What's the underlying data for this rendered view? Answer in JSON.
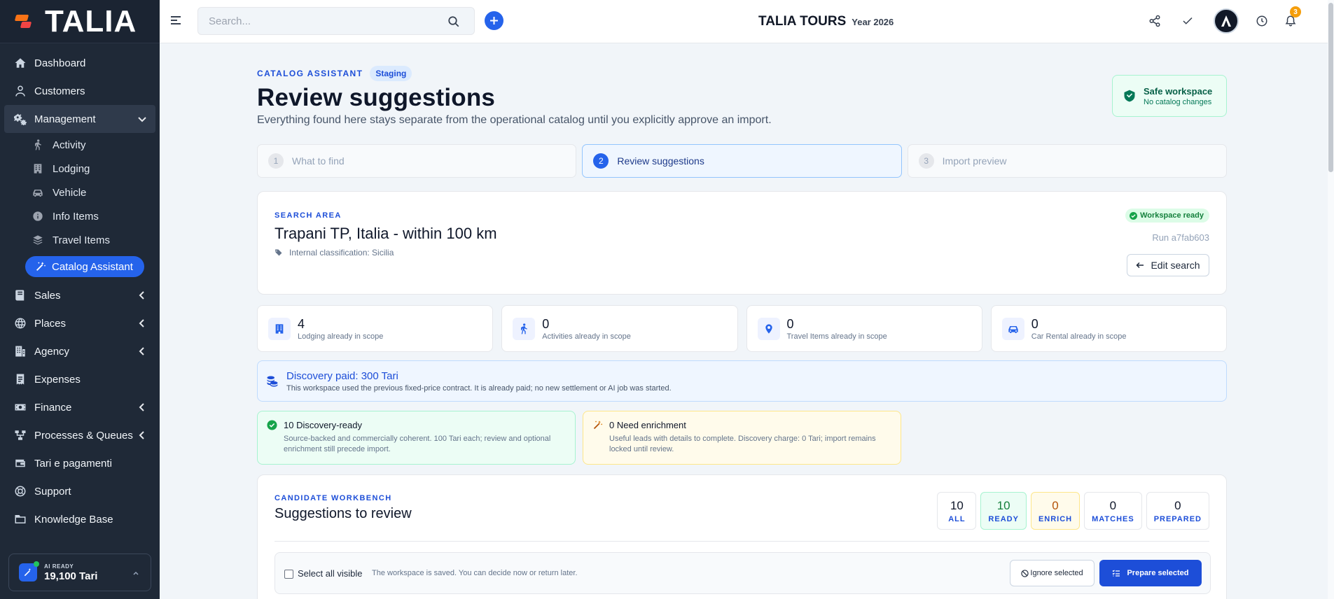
{
  "brand": {
    "name": "TALIA"
  },
  "header": {
    "search_placeholder": "Search...",
    "title": "TALIA TOURS",
    "year": "Year 2026",
    "notification_count": "3"
  },
  "sidebar": {
    "items": [
      {
        "label": "Dashboard",
        "icon": "home-icon"
      },
      {
        "label": "Customers",
        "icon": "user-icon"
      },
      {
        "label": "Management",
        "icon": "gears-icon",
        "expanded": true
      },
      {
        "label": "Sales",
        "icon": "book-icon"
      },
      {
        "label": "Places",
        "icon": "globe-icon"
      },
      {
        "label": "Agency",
        "icon": "building-icon"
      },
      {
        "label": "Expenses",
        "icon": "receipt-icon"
      },
      {
        "label": "Finance",
        "icon": "banknote-icon"
      },
      {
        "label": "Processes & Queues",
        "icon": "sitemap-icon"
      },
      {
        "label": "Tari e pagamenti",
        "icon": "wallet-icon"
      },
      {
        "label": "Support",
        "icon": "lifebuoy-icon"
      },
      {
        "label": "Knowledge Base",
        "icon": "folder-icon"
      }
    ],
    "sub_items": [
      {
        "label": "Activity",
        "icon": "hiking-icon"
      },
      {
        "label": "Lodging",
        "icon": "hotel-icon"
      },
      {
        "label": "Vehicle",
        "icon": "car-icon"
      },
      {
        "label": "Info Items",
        "icon": "info-icon"
      },
      {
        "label": "Travel Items",
        "icon": "layers-icon"
      }
    ],
    "active_item": "Catalog Assistant",
    "ai_card": {
      "label": "AI READY",
      "value": "19,100 Tari"
    }
  },
  "page": {
    "eyebrow": "CATALOG ASSISTANT",
    "env_badge": "Staging",
    "title": "Review suggestions",
    "subtitle": "Everything found here stays separate from the operational catalog until you explicitly approve an import.",
    "safe_workspace": {
      "title": "Safe workspace",
      "subtitle": "No catalog changes"
    },
    "steps": [
      {
        "num": "1",
        "label": "What to find"
      },
      {
        "num": "2",
        "label": "Review suggestions"
      },
      {
        "num": "3",
        "label": "Import preview"
      }
    ]
  },
  "search_area": {
    "label": "SEARCH AREA",
    "title": "Trapani TP, Italia - within 100 km",
    "classification": "Internal classification: Sicilia",
    "status": "Workspace ready",
    "run_id": "Run a7fab603",
    "edit_label": "Edit search"
  },
  "stats": [
    {
      "value": "4",
      "label": "Lodging already in scope",
      "icon": "hotel-icon"
    },
    {
      "value": "0",
      "label": "Activities already in scope",
      "icon": "hiking-icon"
    },
    {
      "value": "0",
      "label": "Travel Items already in scope",
      "icon": "map-pin-icon"
    },
    {
      "value": "0",
      "label": "Car Rental already in scope",
      "icon": "car-icon"
    }
  ],
  "discovery": {
    "title": "Discovery paid: 300 Tari",
    "text": "This workspace used the previous fixed-price contract. It is already paid; no new settlement or AI job was started."
  },
  "readiness": {
    "ready": {
      "title": "10 Discovery-ready",
      "text": "Source-backed and commercially coherent. 100 Tari each; review and optional enrichment still precede import."
    },
    "enrich": {
      "title": "0 Need enrichment",
      "text": "Useful leads with details to complete. Discovery charge: 0 Tari; import remains locked until review."
    }
  },
  "workbench": {
    "label": "CANDIDATE WORKBENCH",
    "title": "Suggestions to review",
    "filters": [
      {
        "value": "10",
        "label": "ALL"
      },
      {
        "value": "10",
        "label": "READY"
      },
      {
        "value": "0",
        "label": "ENRICH"
      },
      {
        "value": "0",
        "label": "MATCHES"
      },
      {
        "value": "0",
        "label": "PREPARED"
      }
    ],
    "select_all": "Select all visible",
    "note": "The workspace is saved. You can decide now or return later.",
    "ignore_label": "Ignore selected",
    "prepare_label": "Prepare selected"
  }
}
